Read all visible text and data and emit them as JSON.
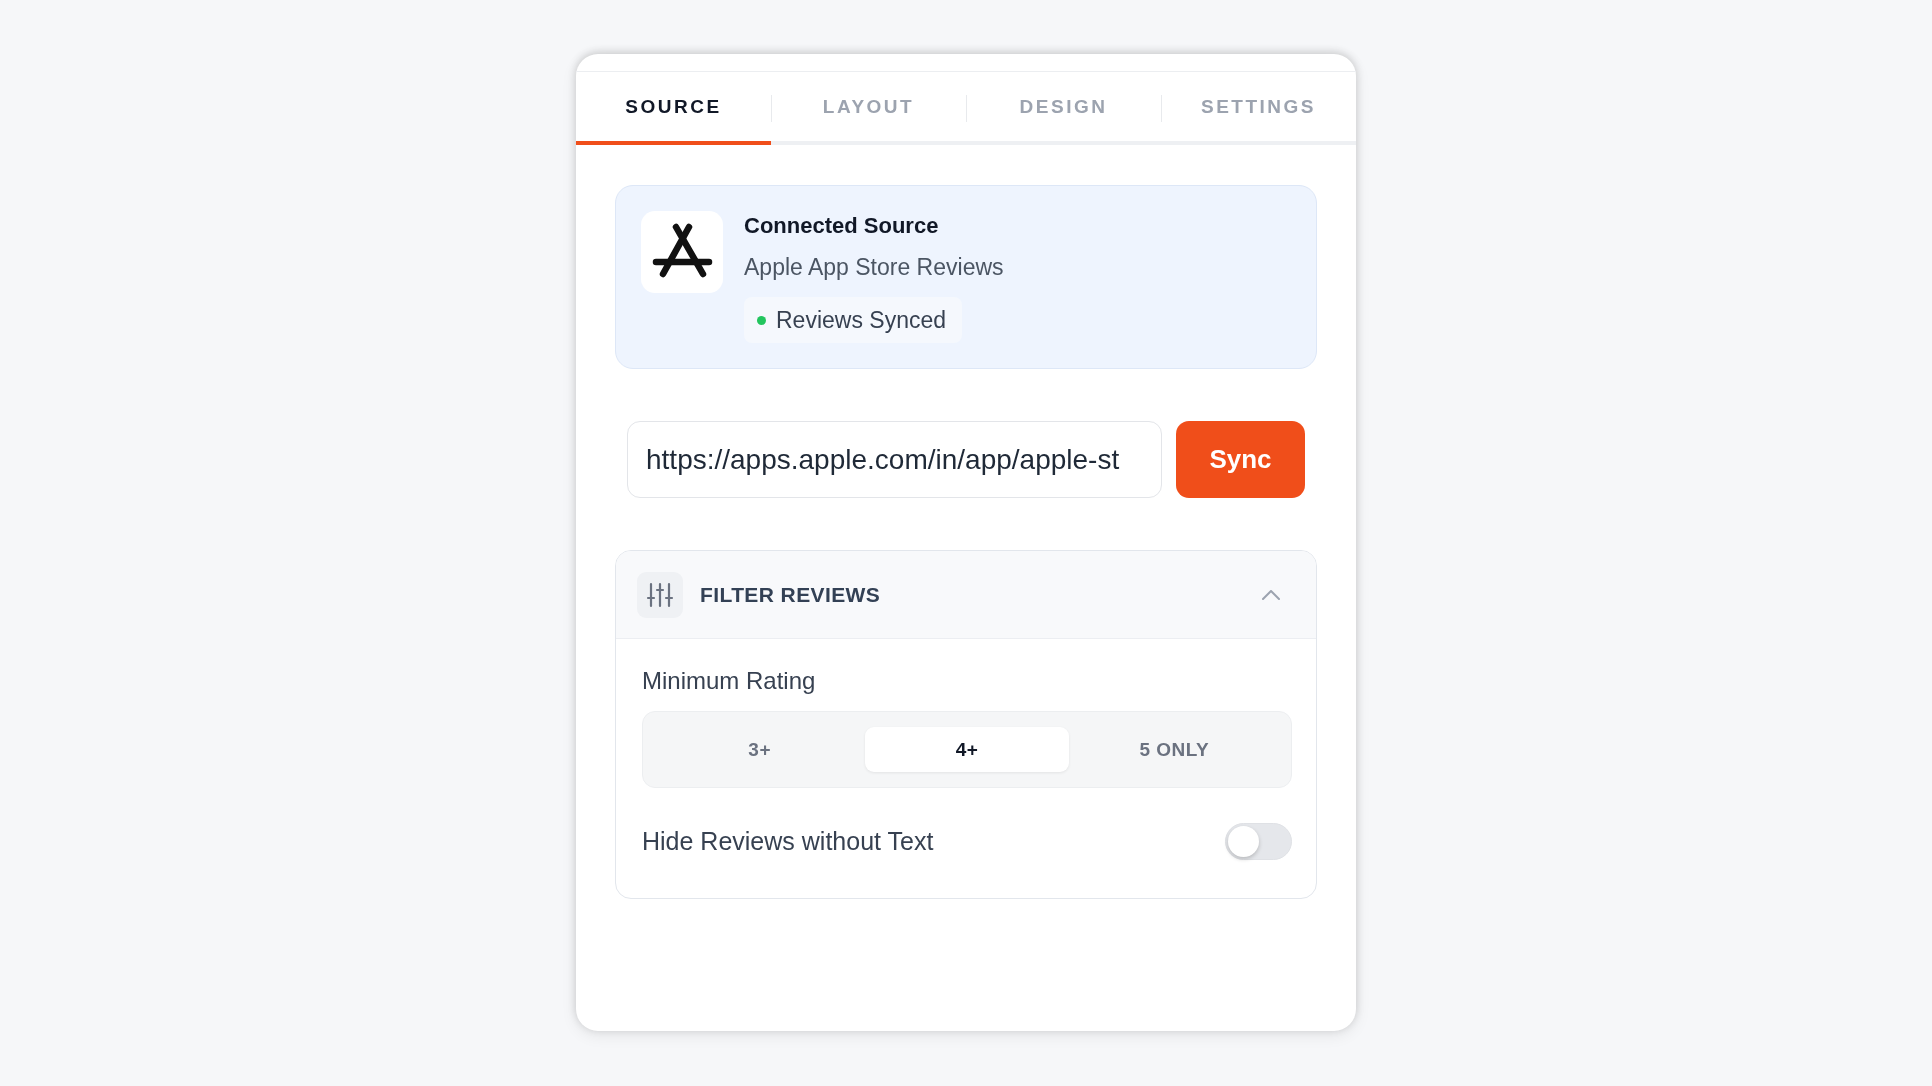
{
  "tabs": [
    {
      "label": "SOURCE",
      "selected": true
    },
    {
      "label": "LAYOUT",
      "selected": false
    },
    {
      "label": "DESIGN",
      "selected": false
    },
    {
      "label": "SETTINGS",
      "selected": false
    }
  ],
  "source_card": {
    "title": "Connected Source",
    "subtitle": "Apple App Store Reviews",
    "status": "Reviews Synced"
  },
  "url_input": {
    "value": "https://apps.apple.com/in/app/apple-st"
  },
  "sync_button": {
    "label": "Sync"
  },
  "filter_panel": {
    "title": "FILTER REVIEWS",
    "expanded": true,
    "rating": {
      "label": "Minimum Rating",
      "options": [
        {
          "label": "3+",
          "selected": false
        },
        {
          "label": "4+",
          "selected": true
        },
        {
          "label": "5 ONLY",
          "selected": false
        }
      ]
    },
    "hide_text_toggle": {
      "label": "Hide Reviews without Text",
      "on": false
    }
  }
}
